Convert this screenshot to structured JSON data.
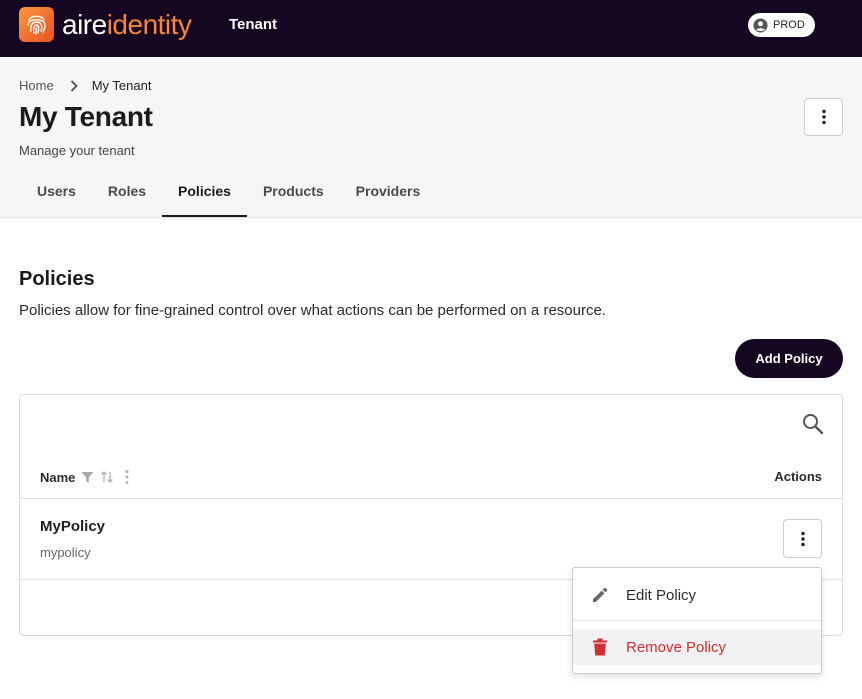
{
  "topbar": {
    "brand_part1": "aire",
    "brand_part2": "identity",
    "title": "Tenant",
    "environment": "PROD"
  },
  "breadcrumb": {
    "home": "Home",
    "current": "My Tenant"
  },
  "header": {
    "title": "My Tenant",
    "subtitle": "Manage your tenant"
  },
  "tabs": [
    {
      "label": "Users",
      "active": false
    },
    {
      "label": "Roles",
      "active": false
    },
    {
      "label": "Policies",
      "active": true
    },
    {
      "label": "Products",
      "active": false
    },
    {
      "label": "Providers",
      "active": false
    }
  ],
  "section": {
    "title": "Policies",
    "description": "Policies allow for fine-grained control over what actions can be performed on a resource.",
    "add_button": "Add Policy"
  },
  "table": {
    "columns": {
      "name": "Name",
      "actions": "Actions"
    },
    "rows": [
      {
        "name": "MyPolicy",
        "id": "mypolicy"
      }
    ]
  },
  "row_menu": {
    "edit": "Edit Policy",
    "remove": "Remove Policy"
  },
  "colors": {
    "topbar_bg": "#150722",
    "brand_accent": "#f5853c",
    "danger": "#d32f2f"
  },
  "icons": [
    "fingerprint-logo-icon",
    "user-circle-icon",
    "chevron-right-icon",
    "more-vertical-icon",
    "search-icon",
    "filter-icon",
    "sort-icon",
    "pencil-icon",
    "trash-icon"
  ]
}
